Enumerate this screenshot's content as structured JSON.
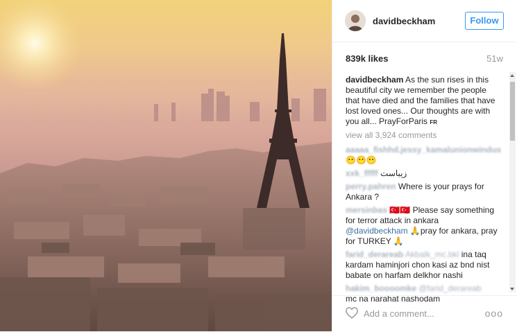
{
  "post": {
    "username": "davidbeckham",
    "follow_label": "Follow",
    "likes": "839k likes",
    "age": "51w",
    "caption": "As the sun rises in this beautiful city we remember the people that have died and the families that have lost loved ones... Our thoughts are with you all... PrayForParis",
    "caption_flag": "FR",
    "view_all": "view all 3,924 comments",
    "add_comment_placeholder": "Add a comment...",
    "more_label": "ooo"
  },
  "comments": [
    {
      "user": "aaaaa_fishhd.jessy_kamalunionwindus",
      "text": "😶😶😶"
    },
    {
      "user": "xxk_fffff",
      "text": "زیباست"
    },
    {
      "user": "perry.pahren",
      "text": "Where is your prays for Ankara ?"
    },
    {
      "user": "mersinbas",
      "text": "🇹🇷🇹🇷 Please say something for terror attack in ankara",
      "mention": "@davidbeckham",
      "text2": "🙏pray for ankara, pray for TURKEY 🙏"
    },
    {
      "user": "farid_derareab",
      "user2": "Akbalk_mc.bkl",
      "text": "ina taq kardam haminjori chon kasi az bnd nist babate on harfam delkhor nashi"
    },
    {
      "user": "hakim_boooomke",
      "user2": "@farid_derareab",
      "text": "mc na narahat nashodam"
    }
  ],
  "colors": {
    "follow_blue": "#3897f0",
    "mention_blue": "#3e6fa3",
    "muted": "#999999"
  },
  "icons": {
    "like": "heart-icon",
    "options": "more-options-icon"
  }
}
